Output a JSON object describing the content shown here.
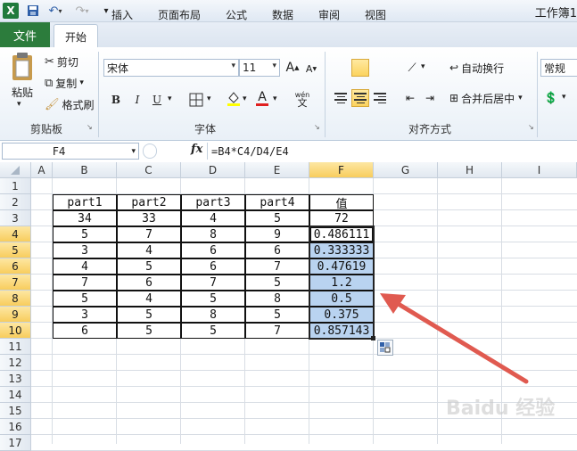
{
  "window": {
    "title": "工作簿1"
  },
  "tabs": [
    {
      "label": "文件"
    },
    {
      "label": "开始"
    },
    {
      "label": "插入"
    },
    {
      "label": "页面布局"
    },
    {
      "label": "公式"
    },
    {
      "label": "数据"
    },
    {
      "label": "审阅"
    },
    {
      "label": "视图"
    }
  ],
  "clipboard": {
    "paste": "粘贴",
    "cut": "剪切",
    "copy": "复制",
    "format_painter": "格式刷",
    "group": "剪贴板"
  },
  "font": {
    "name": "宋体",
    "size": "11",
    "bold": "B",
    "italic": "I",
    "underline": "U",
    "group": "字体",
    "wen": "wén",
    "color_a": "A",
    "grow": "A",
    "shrink": "A"
  },
  "alignment": {
    "wrap": "自动换行",
    "merge": "合并后居中",
    "group": "对齐方式"
  },
  "number": {
    "format": "常规"
  },
  "formula_bar": {
    "name_box": "F4",
    "fx": "fx",
    "formula": "=B4*C4/D4/E4"
  },
  "columns": [
    "A",
    "B",
    "C",
    "D",
    "E",
    "F",
    "G",
    "H",
    "I"
  ],
  "rows": [
    "1",
    "2",
    "3",
    "4",
    "5",
    "6",
    "7",
    "8",
    "9",
    "10",
    "11",
    "12",
    "13",
    "14",
    "15",
    "16",
    "17"
  ],
  "table": {
    "headers": [
      "part1",
      "part2",
      "part3",
      "part4",
      "值"
    ],
    "rows": [
      [
        "34",
        "33",
        "4",
        "5",
        "72"
      ],
      [
        "5",
        "7",
        "8",
        "9",
        "0.486111"
      ],
      [
        "3",
        "4",
        "6",
        "6",
        "0.333333"
      ],
      [
        "4",
        "5",
        "6",
        "7",
        "0.47619"
      ],
      [
        "7",
        "6",
        "7",
        "5",
        "1.2"
      ],
      [
        "5",
        "4",
        "5",
        "8",
        "0.5"
      ],
      [
        "3",
        "5",
        "8",
        "5",
        "0.375"
      ],
      [
        "6",
        "5",
        "5",
        "7",
        "0.857143"
      ]
    ]
  },
  "colors": {
    "file_tab": "#2c7c3c",
    "selection": "#b9d3f0",
    "header_selected": "#f8cd5d",
    "arrow": "#e05a50"
  },
  "watermark": "Baidu 经验"
}
